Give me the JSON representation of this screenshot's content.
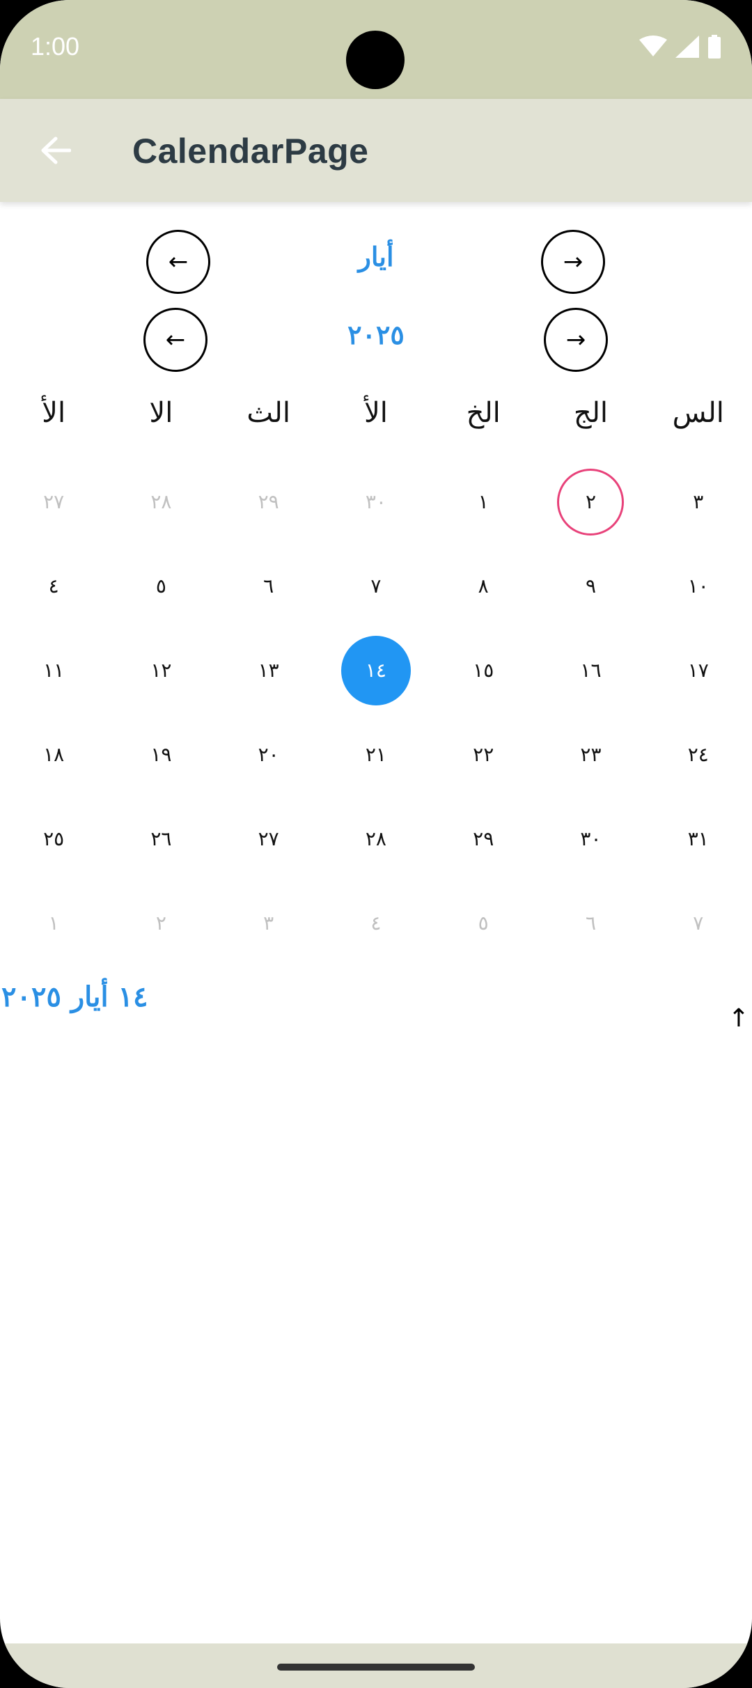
{
  "status_bar": {
    "time": "1:00"
  },
  "app_bar": {
    "title": "CalendarPage",
    "back_icon": "arrow-back-icon"
  },
  "month_nav": {
    "label": "أيار",
    "prev_symbol": "←",
    "next_symbol": "→"
  },
  "year_nav": {
    "label": "٢٠٢٥",
    "prev_symbol": "←",
    "next_symbol": "→"
  },
  "weekdays": [
    "الأ",
    "الا",
    "الث",
    "الأ",
    "الخ",
    "الج",
    "الس"
  ],
  "weeks": [
    [
      {
        "d": "٢٧",
        "m": true
      },
      {
        "d": "٢٨",
        "m": true
      },
      {
        "d": "٢٩",
        "m": true
      },
      {
        "d": "٣٠",
        "m": true
      },
      {
        "d": "١"
      },
      {
        "d": "٢",
        "today": true
      },
      {
        "d": "٣"
      }
    ],
    [
      {
        "d": "٤"
      },
      {
        "d": "٥"
      },
      {
        "d": "٦"
      },
      {
        "d": "٧"
      },
      {
        "d": "٨"
      },
      {
        "d": "٩"
      },
      {
        "d": "١٠"
      }
    ],
    [
      {
        "d": "١١"
      },
      {
        "d": "١٢"
      },
      {
        "d": "١٣"
      },
      {
        "d": "١٤",
        "selected": true
      },
      {
        "d": "١٥"
      },
      {
        "d": "١٦"
      },
      {
        "d": "١٧"
      }
    ],
    [
      {
        "d": "١٨"
      },
      {
        "d": "١٩"
      },
      {
        "d": "٢٠"
      },
      {
        "d": "٢١"
      },
      {
        "d": "٢٢"
      },
      {
        "d": "٢٣"
      },
      {
        "d": "٢٤"
      }
    ],
    [
      {
        "d": "٢٥"
      },
      {
        "d": "٢٦"
      },
      {
        "d": "٢٧"
      },
      {
        "d": "٢٨"
      },
      {
        "d": "٢٩"
      },
      {
        "d": "٣٠"
      },
      {
        "d": "٣١"
      }
    ],
    [
      {
        "d": "١",
        "m": true
      },
      {
        "d": "٢",
        "m": true
      },
      {
        "d": "٣",
        "m": true
      },
      {
        "d": "٤",
        "m": true
      },
      {
        "d": "٥",
        "m": true
      },
      {
        "d": "٦",
        "m": true
      },
      {
        "d": "٧",
        "m": true
      }
    ]
  ],
  "selected_date_text": "١٤ أيار ٢٠٢٥",
  "edge_arrow": "↑",
  "colors": {
    "accent": "#2196f3",
    "today_ring": "#e8427a",
    "status_bar": "#cdd1b3",
    "app_bar": "#e1e2d4"
  }
}
